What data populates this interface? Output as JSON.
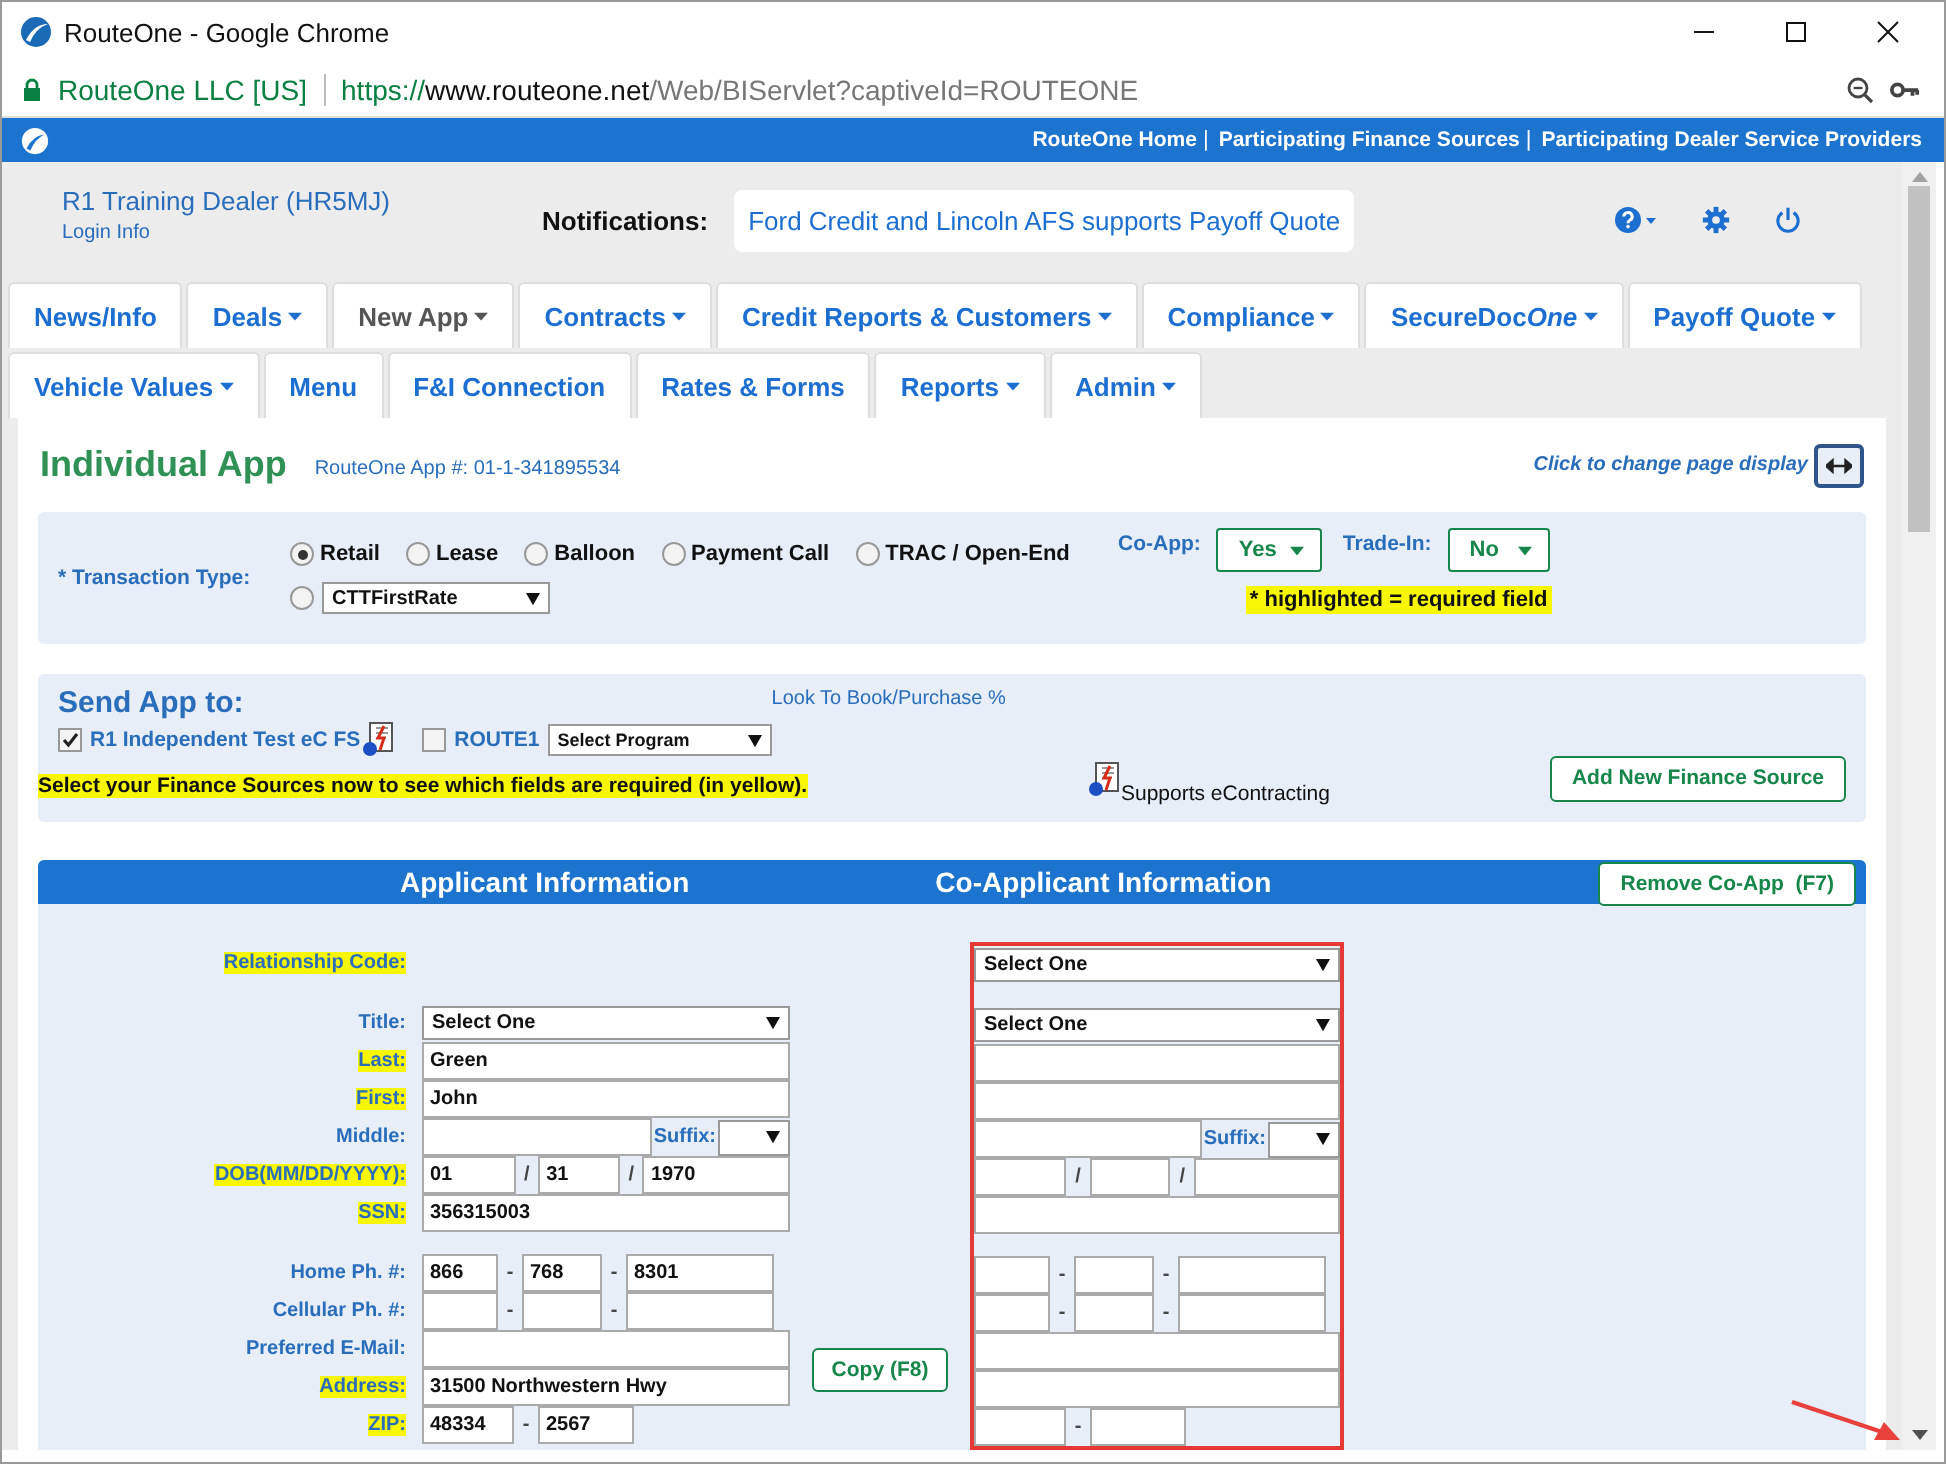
{
  "window": {
    "title": "RouteOne - Google Chrome"
  },
  "address_bar": {
    "site_identity": "RouteOne LLC [US]",
    "url_scheme": "https://",
    "url_host": "www.routeone.net",
    "url_path": "/Web/BIServlet?captiveId=ROUTEONE"
  },
  "top_links": [
    {
      "label": "RouteOne Home",
      "separator": "|"
    },
    {
      "label": "Participating Finance Sources",
      "separator": "|"
    },
    {
      "label": "Participating Dealer Service Providers"
    }
  ],
  "dealer": {
    "name": "R1 Training Dealer (HR5MJ)",
    "login_link": "Login Info"
  },
  "notifications": {
    "label": "Notifications:",
    "message": "Ford Credit and Lincoln AFS supports Payoff Quote"
  },
  "tab_rows": [
    [
      {
        "label": "News/Info",
        "caret": false,
        "selected": false
      },
      {
        "label": "Deals",
        "caret": true,
        "selected": false
      },
      {
        "label": "New App",
        "caret": true,
        "selected": true
      },
      {
        "label": "Contracts",
        "caret": true,
        "selected": false
      },
      {
        "label": "Credit Reports & Customers",
        "caret": true,
        "selected": false
      },
      {
        "label": "Compliance",
        "caret": true,
        "selected": false
      },
      {
        "label": "SecureDoc",
        "label_italic": "One",
        "caret": true,
        "selected": false
      },
      {
        "label": "Payoff Quote",
        "caret": true,
        "selected": false
      }
    ],
    [
      {
        "label": "Vehicle Values",
        "caret": true,
        "selected": false
      },
      {
        "label": "Menu",
        "caret": false,
        "selected": false
      },
      {
        "label": "F&I Connection",
        "caret": false,
        "selected": false
      },
      {
        "label": "Rates & Forms",
        "caret": false,
        "selected": false
      },
      {
        "label": "Reports",
        "caret": true,
        "selected": false
      },
      {
        "label": "Admin",
        "caret": true,
        "selected": false
      }
    ]
  ],
  "page": {
    "title": "Individual App",
    "app_number": "RouteOne App #: 01-1-341895534",
    "display_toggle": "Click to change page display"
  },
  "transaction": {
    "label": "* Transaction Type:",
    "options": [
      {
        "kind": "text",
        "label": "Retail",
        "selected": true
      },
      {
        "kind": "text",
        "label": "Lease",
        "selected": false
      },
      {
        "kind": "text",
        "label": "Balloon",
        "selected": false
      },
      {
        "kind": "text",
        "label": "Payment Call",
        "selected": false
      },
      {
        "kind": "text",
        "label": "TRAC / Open-End",
        "selected": false
      },
      {
        "kind": "select",
        "value": "CTTFirstRate",
        "selected": false
      }
    ],
    "co_app": {
      "label": "Co-App:",
      "value": "Yes"
    },
    "trade_in": {
      "label": "Trade-In:",
      "value": "No"
    },
    "required_note": "* highlighted = required field"
  },
  "send_app": {
    "title": "Send App to:",
    "link": "Look To Book/Purchase %",
    "sources": [
      {
        "label": "R1 Independent Test eC FS",
        "checked": true,
        "econtracting": true
      },
      {
        "label": "ROUTE1",
        "checked": false,
        "econtracting": false,
        "program": "Select Program"
      }
    ],
    "note": "Select your Finance Sources now to see which fields are required (in yellow).",
    "legend": "Supports eContracting",
    "add_button": "Add New Finance Source"
  },
  "applicant_form": {
    "applicant_title": "Applicant Information",
    "co_applicant_title": "Co-Applicant Information",
    "remove_button": "Remove Co-App  (F7)",
    "copy_button": "Copy (F8)",
    "row_groups": [
      [
        {
          "label": "Relationship Code:",
          "required": true,
          "kind": "select",
          "co": {
            "value": "Select One"
          }
        }
      ],
      [
        {
          "label": "Title:",
          "required": false,
          "kind": "select",
          "applicant": {
            "value": "Select One"
          },
          "co": {
            "value": "Select One"
          }
        },
        {
          "label": "Last:",
          "required": true,
          "kind": "text",
          "applicant": {
            "value": "Green"
          }
        },
        {
          "label": "First:",
          "required": true,
          "kind": "text",
          "applicant": {
            "value": "John"
          }
        },
        {
          "label": "Middle:",
          "required": false,
          "kind": "suffix",
          "applicant": {
            "suffix_label": "Suffix:"
          },
          "co": {
            "suffix_label": "Suffix:"
          }
        },
        {
          "label": "DOB(MM/DD/YYYY):",
          "required": true,
          "kind": "date",
          "applicant": {
            "parts": [
              "01",
              "31",
              "1970"
            ],
            "separators": [
              "/",
              "/"
            ]
          },
          "co": {
            "separators": [
              "/",
              "/"
            ]
          }
        },
        {
          "label": "SSN:",
          "required": true,
          "kind": "text",
          "applicant": {
            "value": "356315003"
          }
        }
      ],
      [
        {
          "label": "Home Ph. #:",
          "required": false,
          "kind": "phone",
          "applicant": {
            "parts": [
              "866",
              "768",
              "8301"
            ],
            "separators": [
              "-",
              "-"
            ]
          },
          "co": {
            "separators": [
              "-",
              "-"
            ]
          }
        },
        {
          "label": "Cellular Ph. #:",
          "required": false,
          "kind": "phone",
          "applicant": {
            "separators": [
              "-",
              "-"
            ]
          },
          "co": {
            "separators": [
              "-",
              "-"
            ]
          }
        },
        {
          "label": "Preferred E-Mail:",
          "required": false,
          "kind": "text"
        },
        {
          "label": "Address:",
          "required": true,
          "kind": "text",
          "applicant": {
            "value": "31500 Northwestern Hwy"
          }
        },
        {
          "label": "ZIP:",
          "required": true,
          "kind": "zip",
          "applicant": {
            "parts": [
              "48334",
              "2567"
            ],
            "separators": [
              "-"
            ]
          },
          "co": {
            "separators": [
              "-"
            ]
          }
        }
      ]
    ]
  }
}
